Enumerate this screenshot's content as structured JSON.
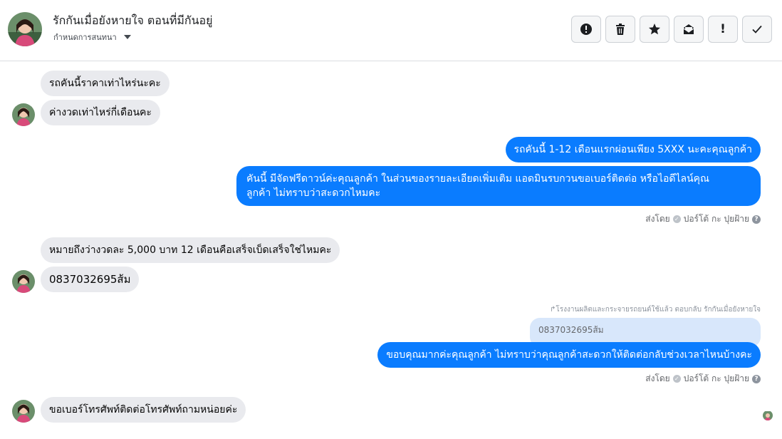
{
  "header": {
    "title": "รักกันเมื่อยังหายใจ ตอนที่มีกันอยู่",
    "subtitle": "กำหนดการสนทนา"
  },
  "toolbar": {
    "icons": [
      "alert-circle-icon",
      "trash-icon",
      "star-icon",
      "mark-unread-icon",
      "exclamation-icon",
      "check-icon"
    ],
    "exclamation_label": "!"
  },
  "messages": [
    {
      "side": "in",
      "text": "รถคันนี้ราคาเท่าไหร่นะคะ"
    },
    {
      "side": "in",
      "text": "ค่างวดเท่าไหร่กี่เดือนคะ"
    },
    {
      "side": "out",
      "text": "รถคันนี้ 1-12 เดือนแรกผ่อนเพียง 5XXX  นะคะคุณลูกค้า"
    },
    {
      "side": "out",
      "text_line1": "คันนี้ มีจัดฟรีดาวน์ค่ะคุณลูกค้า  ในส่วนของรายละเอียดเพิ่มเติม แอดมินรบกวนขอเบอร์ติดต่อ หรือไอดีไลน์คุณ",
      "text_line2": "ลูกค้า ไม่ทราบว่าสะดวกไหมคะ"
    },
    {
      "side": "in",
      "text": "หมายถึงว่างวดละ 5,000 บาท 12 เดือนคือเสร็จเบ็ดเสร็จใช่ไหมคะ"
    },
    {
      "side": "in",
      "text": "0837032695ส้ม"
    },
    {
      "side": "out",
      "text": "ขอบคุณมากค่ะคุณลูกค้า ไม่ทราบว่าคุณลูกค้าสะดวกให้ติดต่อกลับช่วงเวลาไหนบ้างคะ"
    },
    {
      "side": "in",
      "text": "ขอเบอร์โทรศัพท์ติดต่อโทรศัพท์ถามหน่อยค่ะ"
    }
  ],
  "sent_by": {
    "label": "ส่งโดย",
    "name": "ปอร์โต้ กะ ปุยฝ้าย"
  },
  "reply": {
    "note": "โรงงานผลิตและกระจายรถยนต์ใช้แล้ว ตอบกลับ รักกันเมื่อยังหายใจ",
    "quoted_text": "0837032695ส้ม"
  },
  "colors": {
    "outgoing": "#0a7cff",
    "incoming": "#e9eaee",
    "quote": "#d8e7fb"
  }
}
